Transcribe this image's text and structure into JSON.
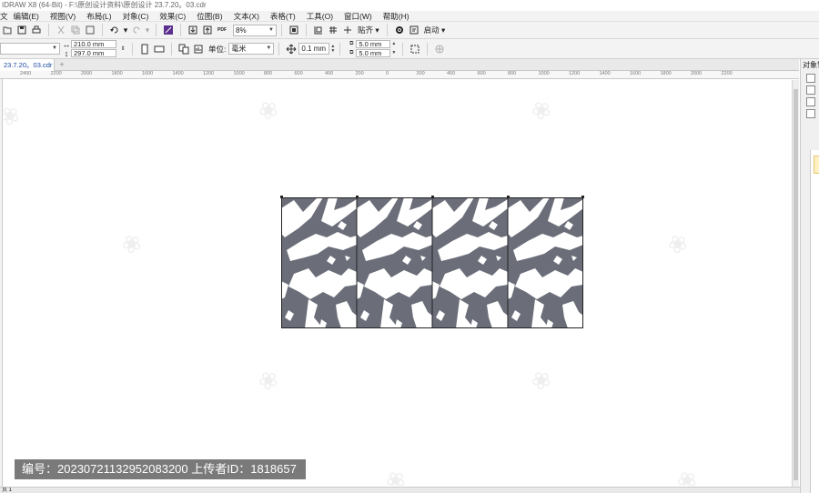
{
  "window": {
    "title": "IDRAW X8 (64-Bit) - F:\\原创设计资料\\原创设计 23.7.20。03.cdr"
  },
  "menu": [
    "文",
    "编辑(E)",
    "视图(V)",
    "布局(L)",
    "对象(C)",
    "效果(C)",
    "位图(B)",
    "文本(X)",
    "表格(T)",
    "工具(O)",
    "窗口(W)",
    "帮助(H)"
  ],
  "toolbar": {
    "zoom_value": "8%",
    "snap_label": "贴齐",
    "launch_label": "启动",
    "pdf_label": "PDF"
  },
  "property_bar": {
    "width_value": "210.0 mm",
    "height_value": "297.0 mm",
    "units_label": "单位:",
    "units_value": "毫米",
    "nudge_value": "0.1 mm",
    "dup_x_value": "5.0 mm",
    "dup_y_value": "5.0 mm"
  },
  "document_tab": {
    "label": "23.7.20。03.cdr"
  },
  "ruler_ticks": [
    "2400",
    "2200",
    "2000",
    "1800",
    "1600",
    "1400",
    "1200",
    "1000",
    "800",
    "600",
    "400",
    "200",
    "0",
    "200",
    "400",
    "600",
    "800",
    "1000",
    "1200",
    "1400",
    "1600",
    "1800",
    "2000",
    "2200"
  ],
  "dock": {
    "title": "对象管理"
  },
  "status": {
    "page_label": "页 1"
  },
  "watermark_credit": "编号：20230721132952083200  上传者ID：1818657",
  "colors": {
    "artwork_fill": "#6b6e79",
    "artwork_light": "#ffffff",
    "accent": "#1b4aa0"
  }
}
